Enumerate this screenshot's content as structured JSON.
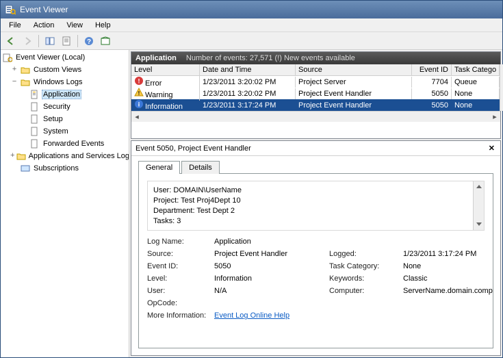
{
  "window": {
    "title": "Event Viewer"
  },
  "menu": {
    "file": "File",
    "action": "Action",
    "view": "View",
    "help": "Help"
  },
  "tree": {
    "root": "Event Viewer (Local)",
    "custom": "Custom Views",
    "winlogs": "Windows Logs",
    "application": "Application",
    "security": "Security",
    "setup": "Setup",
    "system": "System",
    "forwarded": "Forwarded Events",
    "appsvc": "Applications and Services Logs",
    "subs": "Subscriptions"
  },
  "header": {
    "source": "Application",
    "count_label": "Number of events: 27,571 (!) New events available"
  },
  "grid": {
    "cols": {
      "level": "Level",
      "date": "Date and Time",
      "source": "Source",
      "eid": "Event ID",
      "cat": "Task Catego"
    },
    "rows": [
      {
        "icon": "error",
        "level": "Error",
        "date": "1/23/2011 3:20:02 PM",
        "source": "Project Server",
        "eid": "7704",
        "cat": "Queue",
        "selected": false
      },
      {
        "icon": "warning",
        "level": "Warning",
        "date": "1/23/2011 3:20:02 PM",
        "source": "Project Event Handler",
        "eid": "5050",
        "cat": "None",
        "selected": false
      },
      {
        "icon": "info",
        "level": "Information",
        "date": "1/23/2011 3:17:24 PM",
        "source": "Project Event Handler",
        "eid": "5050",
        "cat": "None",
        "selected": true
      }
    ]
  },
  "detail": {
    "title": "Event 5050, Project Event Handler",
    "tabs": {
      "general": "General",
      "details": "Details"
    },
    "message": [
      "User: DOMAIN\\UserName",
      "Project: Test Proj4Dept 10",
      "Department: Test Dept 2",
      "Tasks: 3"
    ],
    "props": {
      "logname_l": "Log Name:",
      "logname_v": "Application",
      "source_l": "Source:",
      "source_v": "Project Event Handler",
      "logged_l": "Logged:",
      "logged_v": "1/23/2011 3:17:24 PM",
      "eid_l": "Event ID:",
      "eid_v": "5050",
      "taskcat_l": "Task Category:",
      "taskcat_v": "None",
      "level_l": "Level:",
      "level_v": "Information",
      "keywords_l": "Keywords:",
      "keywords_v": "Classic",
      "user_l": "User:",
      "user_v": "N/A",
      "computer_l": "Computer:",
      "computer_v": "ServerName.domain.company.com",
      "opcode_l": "OpCode:",
      "opcode_v": "",
      "moreinfo_l": "More Information:",
      "moreinfo_link": "Event Log Online Help"
    }
  }
}
